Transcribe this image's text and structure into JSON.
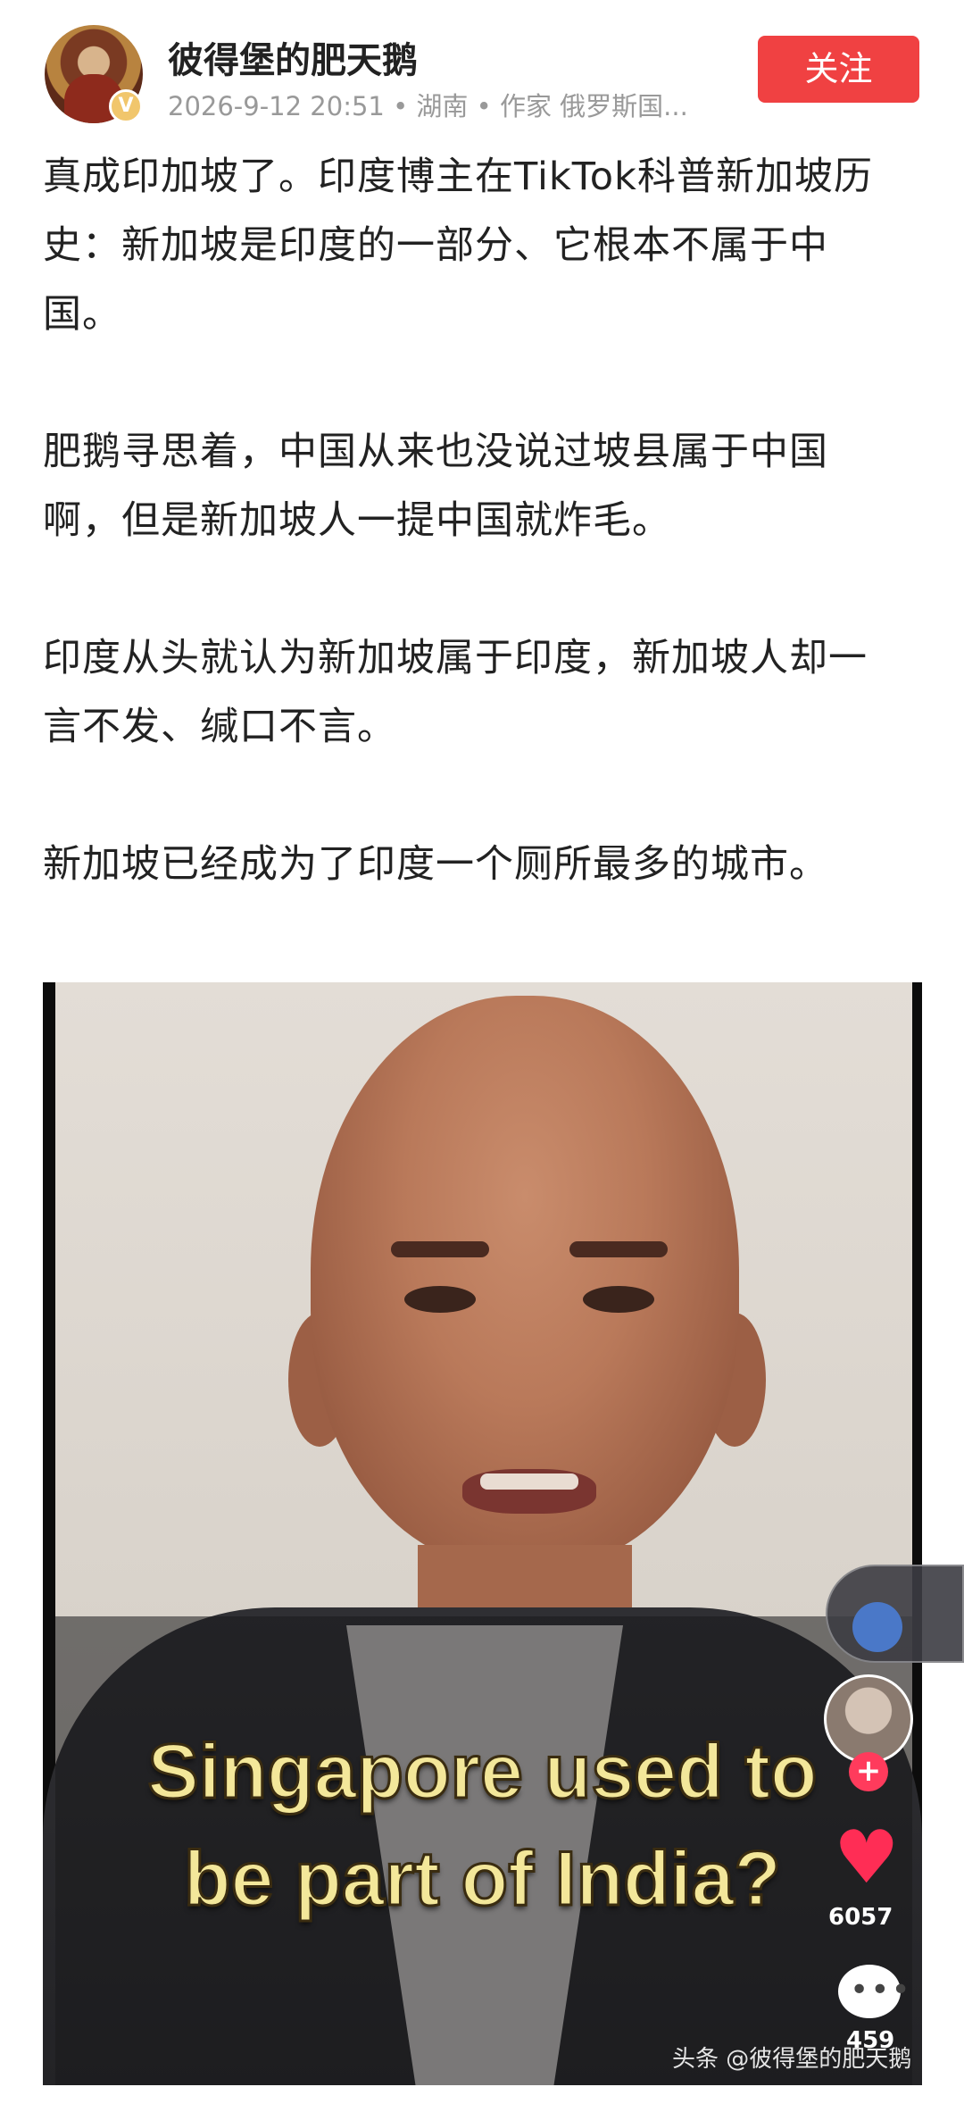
{
  "author": {
    "name": "彼得堡的肥天鹅",
    "verified_badge": "V",
    "meta": "2026-9-12 20:51 • 湖南 • 作家 俄罗斯国...",
    "follow_label": "关注",
    "avatar_icon": "icon-avatar"
  },
  "article": {
    "paragraphs": [
      "真成印加坡了。印度博主在TikTok科普新加坡历史：新加坡是印度的一部分、它根本不属于中国。",
      "肥鹅寻思着，中国从来也没说过坡县属于中国啊，但是新加坡人一提中国就炸毛。",
      "印度从头就认为新加坡属于印度，新加坡人却一言不发、缄口不言。",
      "新加坡已经成为了印度一个厕所最多的城市。"
    ]
  },
  "image": {
    "caption_line1": "Singapore used to",
    "caption_line2": "be part of India?",
    "likes": "6057",
    "comments": "459",
    "watermark": "头条 @彼得堡的肥天鹅",
    "plus": "+",
    "heart": "♥",
    "comment_glyph": "•••"
  },
  "colors": {
    "follow_bg": "#f04142",
    "caption": "#f3e79a",
    "heart": "#ff2d55"
  }
}
